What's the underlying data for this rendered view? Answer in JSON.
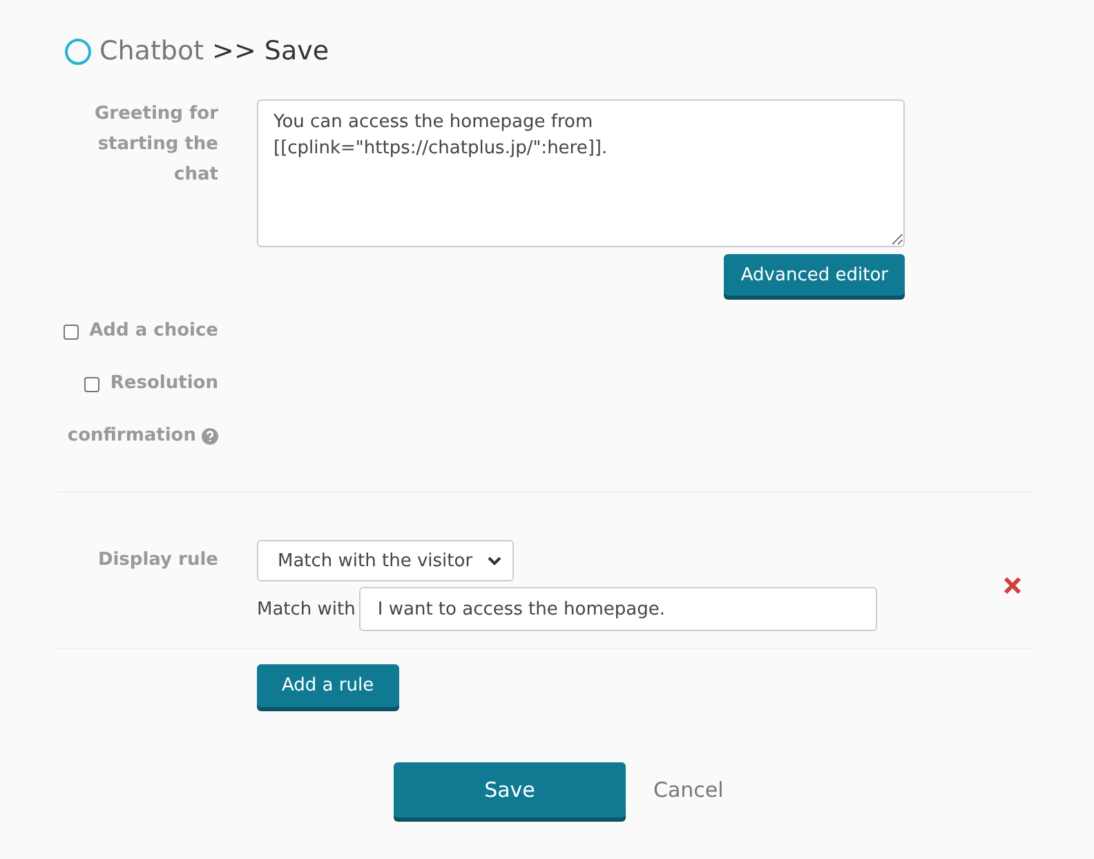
{
  "title": {
    "section": "Chatbot",
    "page": ">> Save"
  },
  "greeting": {
    "label": "Greeting for starting the chat",
    "value": "You can access the homepage from\n[[cplink=\"https://chatplus.jp/\":here]].",
    "button": "Advanced editor"
  },
  "options": [
    {
      "label_lines": [
        "Add a choice"
      ],
      "checked": false,
      "help": false
    },
    {
      "label_lines": [
        "Resolution",
        "confirmation"
      ],
      "checked": false,
      "help": true
    }
  ],
  "display_rule": {
    "label": "Display rule",
    "select": "Match with the visitor",
    "match_label": "Match with",
    "match_value": "I want to access the homepage.",
    "add_button": "Add a rule"
  },
  "actions": {
    "save": "Save",
    "cancel": "Cancel"
  }
}
